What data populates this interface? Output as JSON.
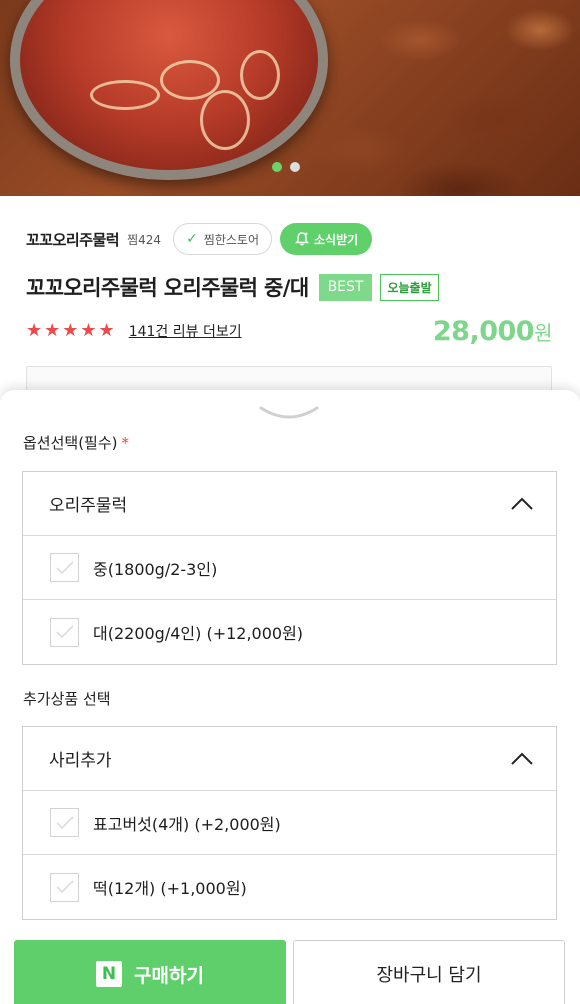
{
  "hero": {
    "image_alt": "오리주물럭",
    "slide_count": 2,
    "active_slide": 1
  },
  "store": {
    "name": "꼬꼬오리주물럭",
    "fav_count": "찜424",
    "fav_button_label": "찜한스토어",
    "alert_button_label": "소식받기"
  },
  "product": {
    "title": "꼬꼬오리주물럭 오리주물럭 중/대",
    "badge_best": "BEST",
    "badge_today": "오늘출발",
    "stars": "★★★★★",
    "rating": 5,
    "review_text": "141건 리뷰 더보기",
    "price": "28,000",
    "price_unit": "원"
  },
  "options": {
    "section_label": "옵션선택(필수)",
    "required_mark": "*",
    "group_name": "오리주물럭",
    "items": [
      {
        "label": "중(1800g/2-3인)"
      },
      {
        "label": "대(2200g/4인) (+12,000원)"
      }
    ]
  },
  "addons": {
    "section_label": "추가상품 선택",
    "group_name": "사리추가",
    "items": [
      {
        "label": "표고버섯(4개) (+2,000원)"
      },
      {
        "label": "떡(12개) (+1,000원)"
      }
    ]
  },
  "bottom": {
    "npay_letter": "N",
    "buy_label": "구매하기",
    "cart_label": "장바구니 담기"
  },
  "colors": {
    "accent_green": "#5fcf6c",
    "price_green": "#7dd68c",
    "star_red": "#ef4a4a"
  }
}
